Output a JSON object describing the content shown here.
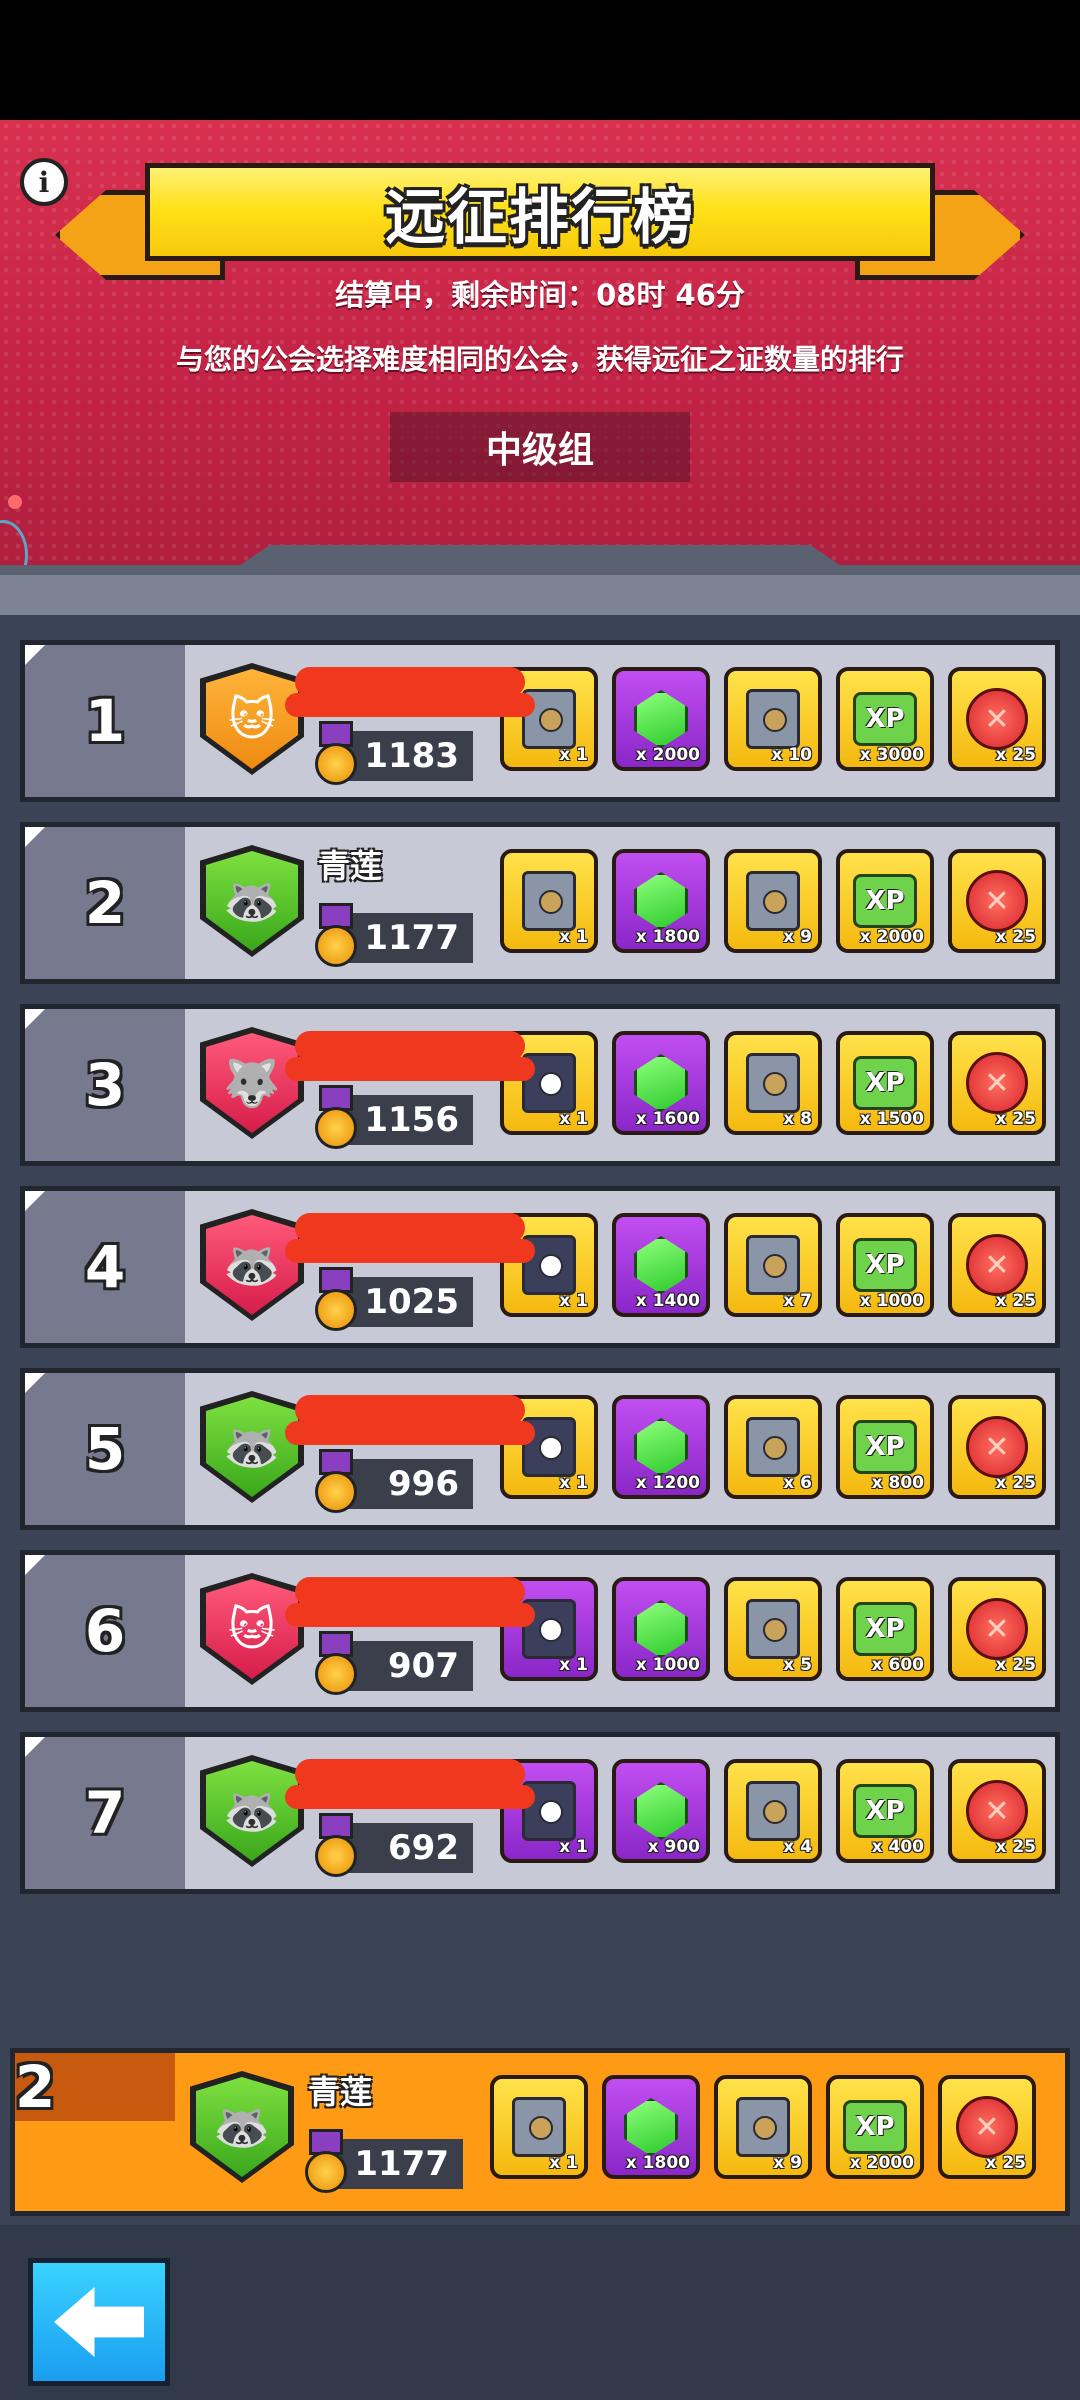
{
  "header": {
    "title": "远征排行榜",
    "settle_text": "结算中，剩余时间：08时 46分",
    "description": "与您的公会选择难度相同的公会，获得远征之证数量的排行",
    "group_label": "中级组"
  },
  "colors": {
    "header_red": "#c42346",
    "banner_yellow": "#ffe11a",
    "row_gray": "#c8c9d6",
    "my_row_orange": "#ff9a14",
    "back_blue": "#1a9ef0"
  },
  "rows": [
    {
      "rank": "1",
      "name": "",
      "score": "1183",
      "emblem": "cat-icon",
      "color": "orange",
      "rewards": [
        {
          "kind": "chest",
          "style": "gold",
          "qty": "x 1"
        },
        {
          "kind": "gem",
          "style": "purple",
          "qty": "x 2000"
        },
        {
          "kind": "chest",
          "style": "gold",
          "qty": "x 10"
        },
        {
          "kind": "xp",
          "style": "gold",
          "qty": "x 3000"
        },
        {
          "kind": "seal",
          "style": "gold",
          "qty": "x 25"
        }
      ]
    },
    {
      "rank": "2",
      "name": "青莲",
      "score": "1177",
      "emblem": "raccoon-icon",
      "color": "green",
      "rewards": [
        {
          "kind": "chest",
          "style": "gold",
          "qty": "x 1"
        },
        {
          "kind": "gem",
          "style": "purple",
          "qty": "x 1800"
        },
        {
          "kind": "chest",
          "style": "gold",
          "qty": "x 9"
        },
        {
          "kind": "xp",
          "style": "gold",
          "qty": "x 2000"
        },
        {
          "kind": "seal",
          "style": "gold",
          "qty": "x 25"
        }
      ]
    },
    {
      "rank": "3",
      "name": "",
      "score": "1156",
      "emblem": "wolf-icon",
      "color": "red",
      "rewards": [
        {
          "kind": "chest-dark",
          "style": "gold",
          "qty": "x 1"
        },
        {
          "kind": "gem",
          "style": "purple",
          "qty": "x 1600"
        },
        {
          "kind": "chest",
          "style": "gold",
          "qty": "x 8"
        },
        {
          "kind": "xp",
          "style": "gold",
          "qty": "x 1500"
        },
        {
          "kind": "seal",
          "style": "gold",
          "qty": "x 25"
        }
      ]
    },
    {
      "rank": "4",
      "name": "",
      "score": "1025",
      "emblem": "raccoon-icon",
      "color": "red",
      "rewards": [
        {
          "kind": "chest-dark",
          "style": "gold",
          "qty": "x 1"
        },
        {
          "kind": "gem",
          "style": "purple",
          "qty": "x 1400"
        },
        {
          "kind": "chest",
          "style": "gold",
          "qty": "x 7"
        },
        {
          "kind": "xp",
          "style": "gold",
          "qty": "x 1000"
        },
        {
          "kind": "seal",
          "style": "gold",
          "qty": "x 25"
        }
      ]
    },
    {
      "rank": "5",
      "name": "",
      "score": "996",
      "emblem": "raccoon-icon",
      "color": "green",
      "rewards": [
        {
          "kind": "chest-dark",
          "style": "gold",
          "qty": "x 1"
        },
        {
          "kind": "gem",
          "style": "purple",
          "qty": "x 1200"
        },
        {
          "kind": "chest",
          "style": "gold",
          "qty": "x 6"
        },
        {
          "kind": "xp",
          "style": "gold",
          "qty": "x 800"
        },
        {
          "kind": "seal",
          "style": "gold",
          "qty": "x 25"
        }
      ]
    },
    {
      "rank": "6",
      "name": "",
      "score": "907",
      "emblem": "cat-icon",
      "color": "red",
      "rewards": [
        {
          "kind": "chest-dark",
          "style": "purple",
          "qty": "x 1"
        },
        {
          "kind": "gem",
          "style": "purple",
          "qty": "x 1000"
        },
        {
          "kind": "chest",
          "style": "gold",
          "qty": "x 5"
        },
        {
          "kind": "xp",
          "style": "gold",
          "qty": "x 600"
        },
        {
          "kind": "seal",
          "style": "gold",
          "qty": "x 25"
        }
      ]
    },
    {
      "rank": "7",
      "name": "",
      "score": "692",
      "emblem": "raccoon-icon",
      "color": "green",
      "rewards": [
        {
          "kind": "chest-dark",
          "style": "purple",
          "qty": "x 1"
        },
        {
          "kind": "gem",
          "style": "purple",
          "qty": "x 900"
        },
        {
          "kind": "chest",
          "style": "gold",
          "qty": "x 4"
        },
        {
          "kind": "xp",
          "style": "gold",
          "qty": "x 400"
        },
        {
          "kind": "seal",
          "style": "gold",
          "qty": "x 25"
        }
      ]
    }
  ],
  "my_guild": {
    "rank": "2",
    "name": "青莲",
    "score": "1177",
    "emblem": "raccoon-icon",
    "color": "green",
    "rewards": [
      {
        "kind": "chest",
        "style": "gold",
        "qty": "x 1"
      },
      {
        "kind": "gem",
        "style": "purple",
        "qty": "x 1800"
      },
      {
        "kind": "chest",
        "style": "gold",
        "qty": "x 9"
      },
      {
        "kind": "xp",
        "style": "gold",
        "qty": "x 2000"
      },
      {
        "kind": "seal",
        "style": "gold",
        "qty": "x 25"
      }
    ]
  },
  "xp_label": "XP",
  "back_button": "back-arrow-icon"
}
